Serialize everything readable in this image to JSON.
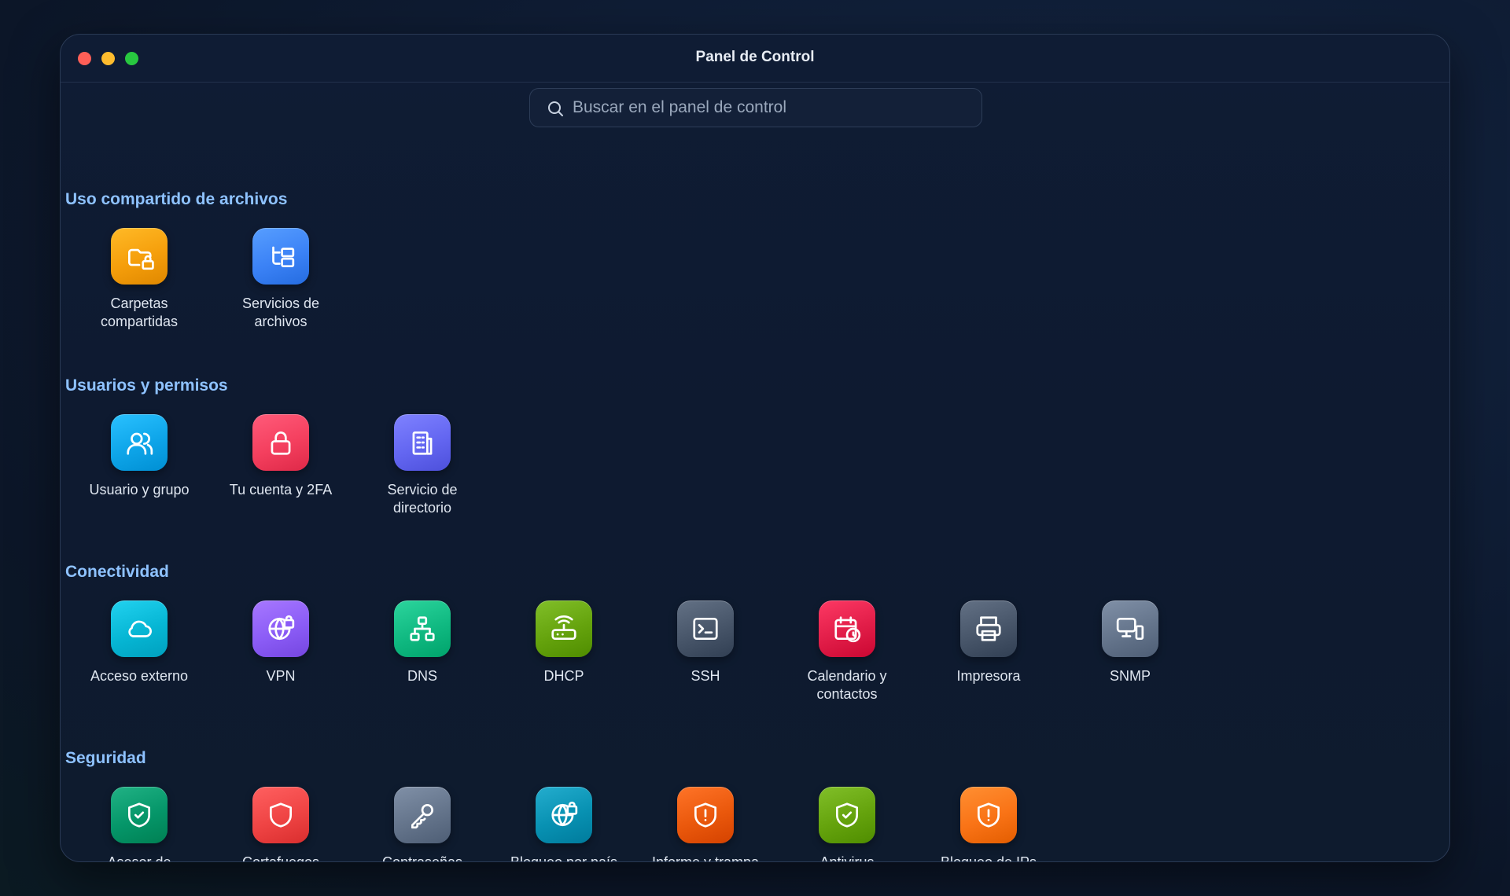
{
  "window": {
    "title": "Panel de Control"
  },
  "search": {
    "placeholder": "Buscar en el panel de control",
    "value": ""
  },
  "sections": [
    {
      "title": "Uso compartido de archivos",
      "items": [
        {
          "label": "Carpetas compartidas",
          "icon": "folder-lock-icon",
          "color": "#f59e0b"
        },
        {
          "label": "Servicios de archivos",
          "icon": "folder-tree-icon",
          "color": "#3b82f6"
        }
      ]
    },
    {
      "title": "Usuarios y permisos",
      "items": [
        {
          "label": "Usuario y grupo",
          "icon": "users-icon",
          "color": "#0ea5e9"
        },
        {
          "label": "Tu cuenta y 2FA",
          "icon": "lock-icon",
          "color": "#f43f5e"
        },
        {
          "label": "Servicio de directorio",
          "icon": "building-icon",
          "color": "#6366f1"
        }
      ]
    },
    {
      "title": "Conectividad",
      "items": [
        {
          "label": "Acceso externo",
          "icon": "cloud-icon",
          "color": "#06b6d4"
        },
        {
          "label": "VPN",
          "icon": "globe-lock-icon",
          "color": "#8b5cf6"
        },
        {
          "label": "DNS",
          "icon": "network-icon",
          "color": "#10b981"
        },
        {
          "label": "DHCP",
          "icon": "router-icon",
          "color": "#65a30d"
        },
        {
          "label": "SSH",
          "icon": "terminal-icon",
          "color": "#475569"
        },
        {
          "label": "Calendario y contactos",
          "icon": "calendar-clock-icon",
          "color": "#e11d48"
        },
        {
          "label": "Impresora",
          "icon": "printer-icon",
          "color": "#475569"
        },
        {
          "label": "SNMP",
          "icon": "monitor-icon",
          "color": "#64748b"
        }
      ]
    },
    {
      "title": "Seguridad",
      "items": [
        {
          "label": "Asesor de seguridad",
          "icon": "shield-check-icon",
          "color": "#059669"
        },
        {
          "label": "Cortafuegos",
          "icon": "shield-icon",
          "color": "#ef4444"
        },
        {
          "label": "Contraseñas",
          "icon": "key-icon",
          "color": "#64748b"
        },
        {
          "label": "Bloqueo por país",
          "icon": "globe-lock-icon",
          "color": "#0891b2"
        },
        {
          "label": "Informe y trampa",
          "icon": "shield-alert-icon",
          "color": "#ea580c"
        },
        {
          "label": "Antivirus",
          "icon": "shield-check-icon",
          "color": "#65a30d"
        },
        {
          "label": "Bloqueo de IPs",
          "icon": "shield-alert-icon",
          "color": "#f97316"
        }
      ]
    }
  ]
}
